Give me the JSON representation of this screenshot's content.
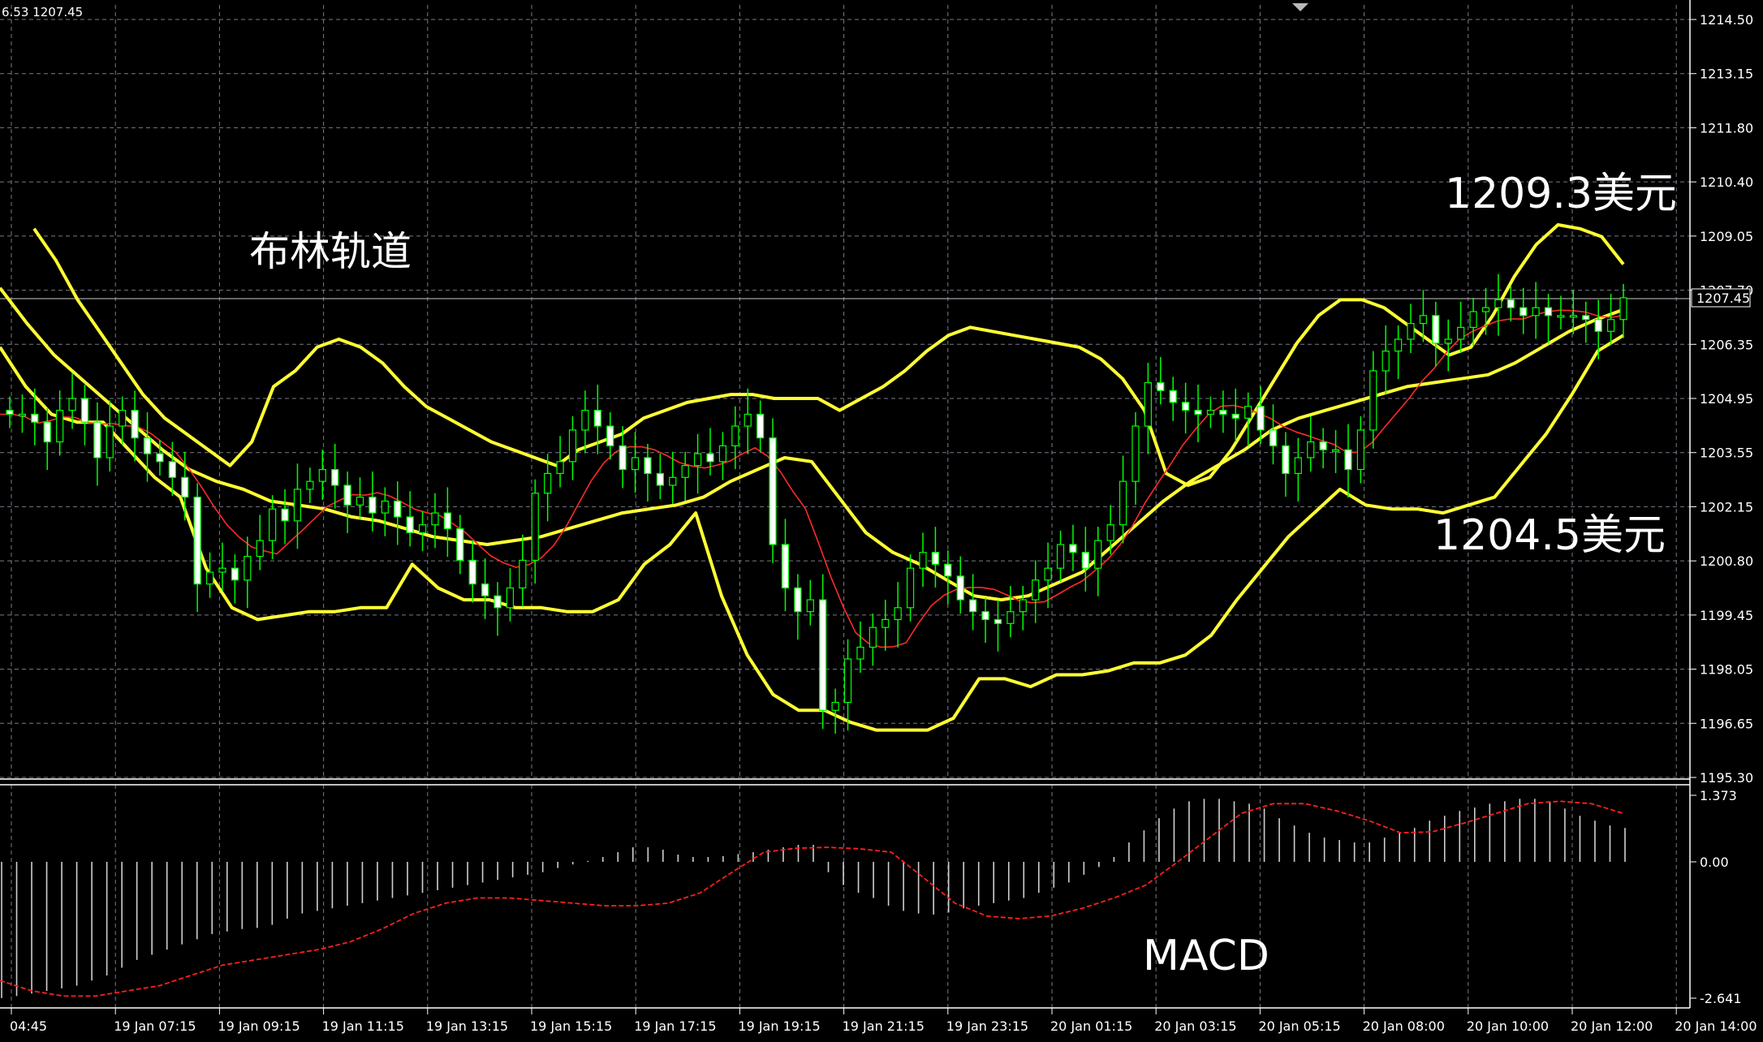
{
  "header": {
    "ohlc_text": "6.53 1207.45"
  },
  "annotations": {
    "bollinger": "布林轨道",
    "upper_value": "1209.3美元",
    "lower_value": "1204.5美元",
    "macd": "MACD"
  },
  "colors": {
    "background": "#000000",
    "grid": "#7a7a8a",
    "bull_candle": "#00ff00",
    "bear_candle": "#ffffff",
    "bollinger": "#ffff33",
    "ma": "#ff2a2a",
    "macd_histogram": "#cfcfcf",
    "macd_signal": "#ff2020",
    "axis_text": "#ffffff"
  },
  "chart_data": [
    {
      "type": "candlestick",
      "title": "",
      "indicators": [
        "Bollinger Bands",
        "Moving Average"
      ],
      "price_axis": {
        "ticks": [
          "1214.50",
          "1213.15",
          "1211.80",
          "1210.40",
          "1209.05",
          "1207.70",
          "1206.35",
          "1204.95",
          "1203.55",
          "1202.15",
          "1200.80",
          "1199.45",
          "1198.05",
          "1196.65",
          "1195.30"
        ],
        "range": [
          1195.3,
          1214.5
        ],
        "current_price": "1207.45"
      },
      "time_axis": {
        "ticks": [
          "04:45",
          "19 Jan 07:15",
          "19 Jan 09:15",
          "19 Jan 11:15",
          "19 Jan 13:15",
          "19 Jan 15:15",
          "19 Jan 17:15",
          "19 Jan 19:15",
          "19 Jan 21:15",
          "19 Jan 23:15",
          "20 Jan 01:15",
          "20 Jan 03:15",
          "20 Jan 05:15",
          "20 Jan 08:00",
          "20 Jan 10:00",
          "20 Jan 12:00",
          "20 Jan 14:00"
        ]
      },
      "close_series": [
        1204.5,
        1204.5,
        1204.3,
        1203.8,
        1204.6,
        1204.9,
        1204.3,
        1203.4,
        1204.2,
        1204.6,
        1203.9,
        1203.5,
        1203.3,
        1202.9,
        1202.4,
        1200.2,
        1200.5,
        1200.6,
        1200.3,
        1200.9,
        1201.3,
        1202.1,
        1201.8,
        1202.6,
        1202.8,
        1203.1,
        1202.7,
        1202.2,
        1202.4,
        1202.0,
        1202.3,
        1201.9,
        1201.5,
        1201.7,
        1202.0,
        1201.6,
        1200.8,
        1200.2,
        1199.9,
        1199.6,
        1200.1,
        1200.8,
        1202.5,
        1203.0,
        1203.3,
        1204.1,
        1204.6,
        1204.2,
        1203.7,
        1203.1,
        1203.4,
        1203.0,
        1202.7,
        1202.9,
        1203.2,
        1203.5,
        1203.3,
        1203.7,
        1204.2,
        1204.5,
        1203.9,
        1201.2,
        1200.1,
        1199.5,
        1199.8,
        1197.0,
        1197.2,
        1198.3,
        1198.6,
        1199.1,
        1199.3,
        1199.6,
        1200.6,
        1201.0,
        1200.7,
        1200.4,
        1199.8,
        1199.5,
        1199.3,
        1199.2,
        1199.5,
        1199.8,
        1200.3,
        1200.6,
        1201.2,
        1201.0,
        1200.6,
        1201.3,
        1201.7,
        1202.8,
        1204.2,
        1205.3,
        1205.1,
        1204.8,
        1204.6,
        1204.5,
        1204.6,
        1204.5,
        1204.4,
        1204.7,
        1204.1,
        1203.7,
        1203.0,
        1203.4,
        1203.8,
        1203.6,
        1203.6,
        1203.1,
        1204.1,
        1205.6,
        1206.1,
        1206.4,
        1206.8,
        1207.0,
        1206.3,
        1206.4,
        1206.7,
        1207.1,
        1207.2,
        1207.4,
        1207.2,
        1207.0,
        1207.2,
        1207.0,
        1207.0,
        1207.0,
        1206.9,
        1206.6,
        1206.9,
        1207.45
      ],
      "bollinger_upper": [
        1209.2,
        1208.4,
        1207.4,
        1206.6,
        1205.8,
        1205.0,
        1204.4,
        1204.0,
        1203.6,
        1203.2,
        1203.8,
        1205.2,
        1205.6,
        1206.2,
        1206.4,
        1206.2,
        1205.8,
        1205.2,
        1204.7,
        1204.4,
        1204.1,
        1203.8,
        1203.6,
        1203.4,
        1203.2,
        1203.6,
        1203.8,
        1204.0,
        1204.4,
        1204.6,
        1204.8,
        1204.9,
        1205.0,
        1205.0,
        1204.9,
        1204.9,
        1204.9,
        1204.6,
        1204.9,
        1205.2,
        1205.6,
        1206.1,
        1206.5,
        1206.7,
        1206.6,
        1206.5,
        1206.4,
        1206.3,
        1206.2,
        1205.9,
        1205.4,
        1204.6,
        1203.0,
        1202.7,
        1202.9,
        1203.6,
        1204.5,
        1205.4,
        1206.3,
        1207.0,
        1207.4,
        1207.4,
        1207.2,
        1206.8,
        1206.4,
        1206.0,
        1206.2,
        1207.0,
        1208.0,
        1208.8,
        1209.3,
        1209.2,
        1209.0,
        1208.3
      ],
      "bollinger_middle": [
        1207.7,
        1206.8,
        1206.0,
        1205.4,
        1204.8,
        1204.2,
        1203.6,
        1203.1,
        1202.8,
        1202.6,
        1202.3,
        1202.2,
        1202.1,
        1201.9,
        1201.8,
        1201.6,
        1201.4,
        1201.3,
        1201.2,
        1201.3,
        1201.4,
        1201.6,
        1201.8,
        1202.0,
        1202.1,
        1202.2,
        1202.4,
        1202.8,
        1203.1,
        1203.4,
        1203.3,
        1202.4,
        1201.5,
        1201.0,
        1200.7,
        1200.3,
        1199.9,
        1199.8,
        1199.9,
        1200.2,
        1200.5,
        1201.1,
        1201.7,
        1202.3,
        1202.8,
        1203.2,
        1203.6,
        1204.1,
        1204.4,
        1204.6,
        1204.8,
        1205.0,
        1205.2,
        1205.3,
        1205.4,
        1205.5,
        1205.8,
        1206.2,
        1206.6,
        1206.9,
        1207.15
      ],
      "bollinger_lower": [
        1206.2,
        1205.2,
        1204.5,
        1204.3,
        1204.3,
        1203.6,
        1202.9,
        1202.4,
        1200.6,
        1199.6,
        1199.3,
        1199.4,
        1199.5,
        1199.5,
        1199.6,
        1199.6,
        1200.7,
        1200.1,
        1199.8,
        1199.8,
        1199.6,
        1199.6,
        1199.5,
        1199.5,
        1199.8,
        1200.7,
        1201.2,
        1202.0,
        1199.9,
        1198.4,
        1197.4,
        1197.0,
        1197.0,
        1196.7,
        1196.5,
        1196.5,
        1196.5,
        1196.8,
        1197.8,
        1197.8,
        1197.6,
        1197.9,
        1197.9,
        1198.0,
        1198.2,
        1198.2,
        1198.4,
        1198.9,
        1199.8,
        1200.6,
        1201.4,
        1202.0,
        1202.6,
        1202.2,
        1202.1,
        1202.1,
        1202.0,
        1202.2,
        1202.4,
        1203.2,
        1204.0,
        1205.0,
        1206.1,
        1206.5
      ]
    },
    {
      "type": "bar",
      "title": "",
      "indicator": "MACD",
      "y_axis": {
        "ticks": [
          "1.373",
          "0.00",
          "-2.641"
        ],
        "range": [
          -2.641,
          1.373
        ]
      },
      "histogram": [
        -2.64,
        -2.6,
        -2.55,
        -2.5,
        -2.45,
        -2.4,
        -2.3,
        -2.2,
        -2.05,
        -1.9,
        -1.8,
        -1.7,
        -1.6,
        -1.5,
        -1.4,
        -1.35,
        -1.3,
        -1.28,
        -1.22,
        -1.1,
        -1.0,
        -0.95,
        -0.9,
        -0.85,
        -0.8,
        -0.75,
        -0.7,
        -0.65,
        -0.6,
        -0.55,
        -0.5,
        -0.45,
        -0.4,
        -0.35,
        -0.3,
        -0.25,
        -0.2,
        -0.12,
        -0.05,
        0.02,
        0.1,
        0.2,
        0.3,
        0.3,
        0.25,
        0.15,
        0.1,
        0.1,
        0.12,
        0.16,
        0.2,
        0.25,
        0.3,
        0.35,
        0.35,
        -0.2,
        -0.45,
        -0.6,
        -0.7,
        -0.85,
        -0.95,
        -1.0,
        -1.02,
        -0.98,
        -0.9,
        -0.85,
        -0.8,
        -0.75,
        -0.7,
        -0.6,
        -0.5,
        -0.4,
        -0.25,
        -0.1,
        0.1,
        0.4,
        0.65,
        0.9,
        1.1,
        1.25,
        1.3,
        1.3,
        1.25,
        1.2,
        1.1,
        0.9,
        0.75,
        0.6,
        0.5,
        0.45,
        0.4,
        0.4,
        0.5,
        0.6,
        0.7,
        0.85,
        0.95,
        1.05,
        1.12,
        1.2,
        1.25,
        1.3,
        1.3,
        1.25,
        1.1,
        0.95,
        0.85,
        0.75,
        0.7
      ],
      "signal": [
        -2.3,
        -2.5,
        -2.6,
        -2.6,
        -2.5,
        -2.4,
        -2.2,
        -2.0,
        -1.9,
        -1.8,
        -1.7,
        -1.55,
        -1.3,
        -1.0,
        -0.8,
        -0.7,
        -0.7,
        -0.75,
        -0.8,
        -0.85,
        -0.85,
        -0.8,
        -0.6,
        -0.2,
        0.2,
        0.28,
        0.3,
        0.27,
        0.2,
        -0.3,
        -0.8,
        -1.05,
        -1.1,
        -1.05,
        -0.9,
        -0.7,
        -0.45,
        0.0,
        0.5,
        1.0,
        1.2,
        1.2,
        1.05,
        0.85,
        0.6,
        0.62,
        0.8,
        1.0,
        1.2,
        1.25,
        1.2,
        1.0
      ]
    }
  ]
}
